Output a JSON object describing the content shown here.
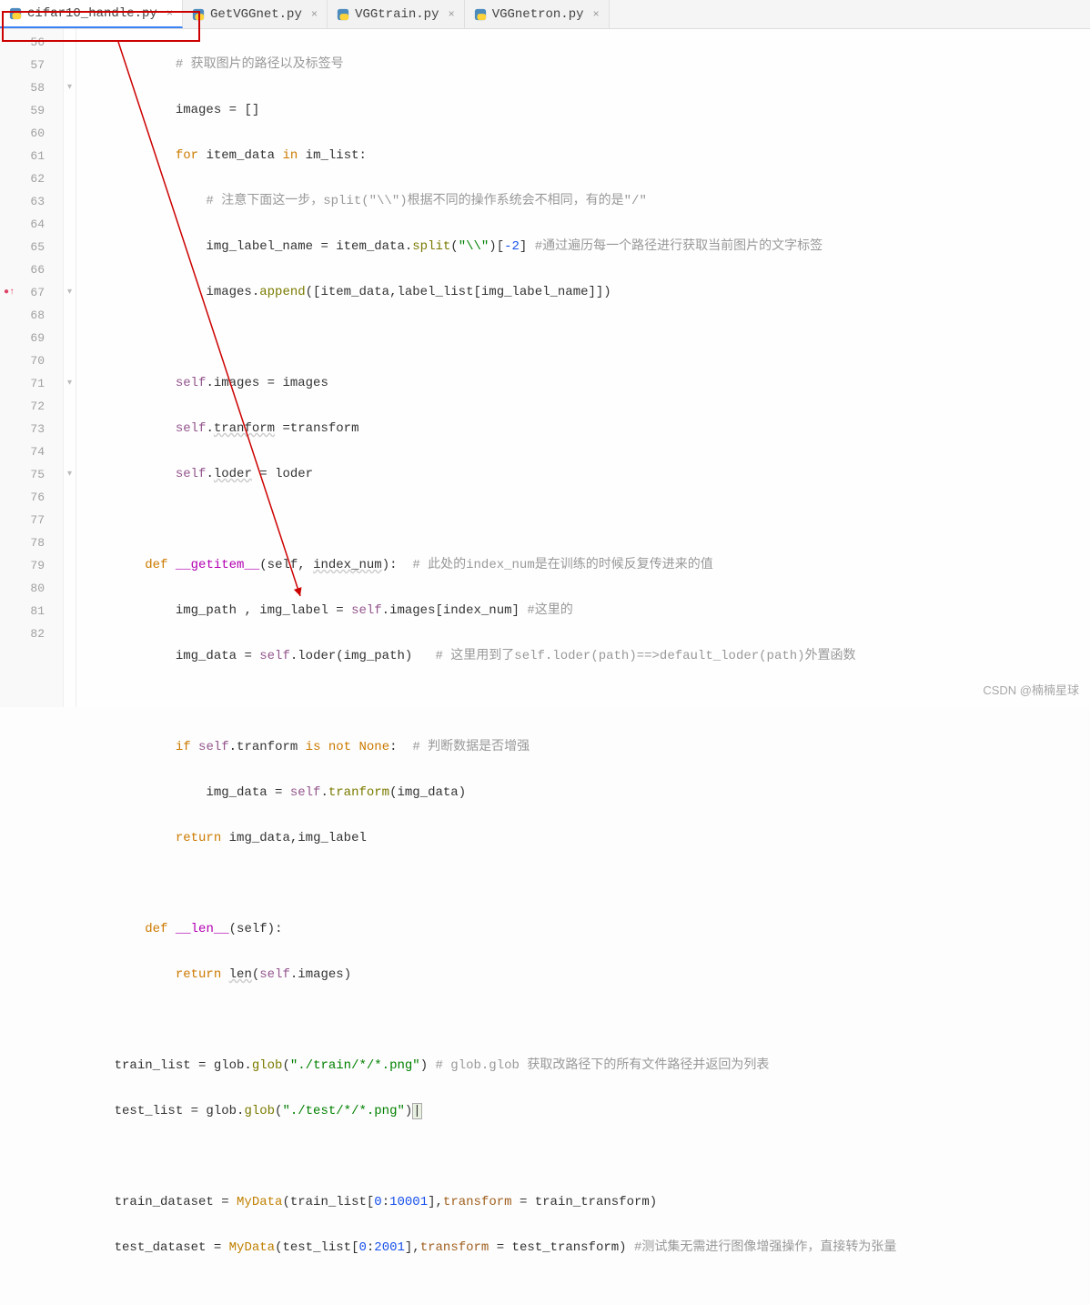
{
  "tabs": [
    {
      "label": "cifar10_handle.py",
      "active": true
    },
    {
      "label": "GetVGGnet.py",
      "active": false
    },
    {
      "label": "VGGtrain.py",
      "active": false
    },
    {
      "label": "VGGnetron.py",
      "active": false
    }
  ],
  "lines": {
    "start": 56,
    "end": 82
  },
  "code": {
    "l56": {
      "indent": "            ",
      "comment": "# 获取图片的路径以及标签号"
    },
    "l57": {
      "indent": "            ",
      "text1": "images = []"
    },
    "l58": {
      "indent": "            ",
      "kw": "for",
      "mid": " item_data ",
      "kw2": "in",
      "rest": " im_list:"
    },
    "l59": {
      "indent": "                ",
      "comment": "# 注意下面这一步，split(\"\\\\\")根据不同的操作系统会不相同，有的是\"/\""
    },
    "l60": {
      "indent": "                ",
      "lhs": "img_label_name = item_data.",
      "fn": "split",
      "args": "(",
      "str": "\"\\\\\"",
      "after": ")[",
      "num": "-2",
      "close": "] ",
      "comment": "#通过遍历每一个路径进行获取当前图片的文字标签"
    },
    "l61": {
      "indent": "                ",
      "obj": "images.",
      "fn": "append",
      "args": "([item_data,label_list[img_label_name]])"
    },
    "l63": {
      "indent": "            ",
      "self": "self",
      "rest": ".images = images"
    },
    "l64": {
      "indent": "            ",
      "self": "self",
      "dot": ".",
      "attr": "tranform",
      "rest": " =transform"
    },
    "l65": {
      "indent": "            ",
      "self": "self",
      "dot": ".",
      "attr": "loder",
      "rest": " = loder"
    },
    "l67": {
      "indent": "        ",
      "kw": "def",
      "name": " __getitem__",
      "sig": "(self, ",
      "param": "index_num",
      "close": "):",
      "comment": "  # 此处的index_num是在训练的时候反复传进来的值"
    },
    "l68": {
      "indent": "            ",
      "lhs": "img_path , img_label = ",
      "self": "self",
      "rest": ".images[index_num] ",
      "comment": "#这里的"
    },
    "l69": {
      "indent": "            ",
      "lhs": "img_data = ",
      "self": "self",
      "mid": ".loder(img_path)   ",
      "comment": "# 这里用到了self.loder(path)==>default_loder(path)外置函数"
    },
    "l71": {
      "indent": "            ",
      "kw": "if",
      "sp": " ",
      "self": "self",
      "mid": ".tranform ",
      "kw2": "is not",
      "sp2": " ",
      "none": "None",
      "colon": ":",
      "comment": "  # 判断数据是否增强"
    },
    "l72": {
      "indent": "                ",
      "lhs": "img_data = ",
      "self": "self",
      "dot": ".",
      "fn": "tranform",
      "args": "(img_data)"
    },
    "l73": {
      "indent": "            ",
      "kw": "return",
      "rest": " img_data,img_label"
    },
    "l75": {
      "indent": "        ",
      "kw": "def",
      "name": " __len__",
      "sig": "(self):"
    },
    "l76": {
      "indent": "            ",
      "kw": "return",
      "sp": " ",
      "fn": "len",
      "open": "(",
      "self": "self",
      "rest": ".images)"
    },
    "l78": {
      "indent": "    ",
      "lhs": "train_list = glob.",
      "fn": "glob",
      "open": "(",
      "str": "\"./train/*/*.png\"",
      "close": ") ",
      "comment": "# glob.glob 获取改路径下的所有文件路径并返回为列表"
    },
    "l79": {
      "indent": "    ",
      "lhs": "test_list = glob.",
      "fn": "glob",
      "open": "(",
      "str": "\"./test/*/*.png\"",
      "close": ")"
    },
    "l81": {
      "indent": "    ",
      "lhs": "train_dataset = ",
      "cls": "MyData",
      "open": "(train_list[",
      "num1": "0",
      "colon": ":",
      "num2": "10001",
      "mid": "],",
      "param": "transform",
      "eq": " = train_transform)"
    },
    "l82": {
      "indent": "    ",
      "lhs": "test_dataset = ",
      "cls": "MyData",
      "open": "(test_list[",
      "num1": "0",
      "colon": ":",
      "num2": "2001",
      "mid": "],",
      "param": "transform",
      "eq": " = test_transform) ",
      "comment": "#测试集无需进行图像增强操作，直接转为张量"
    }
  },
  "watermark": "CSDN @楠楠星球"
}
